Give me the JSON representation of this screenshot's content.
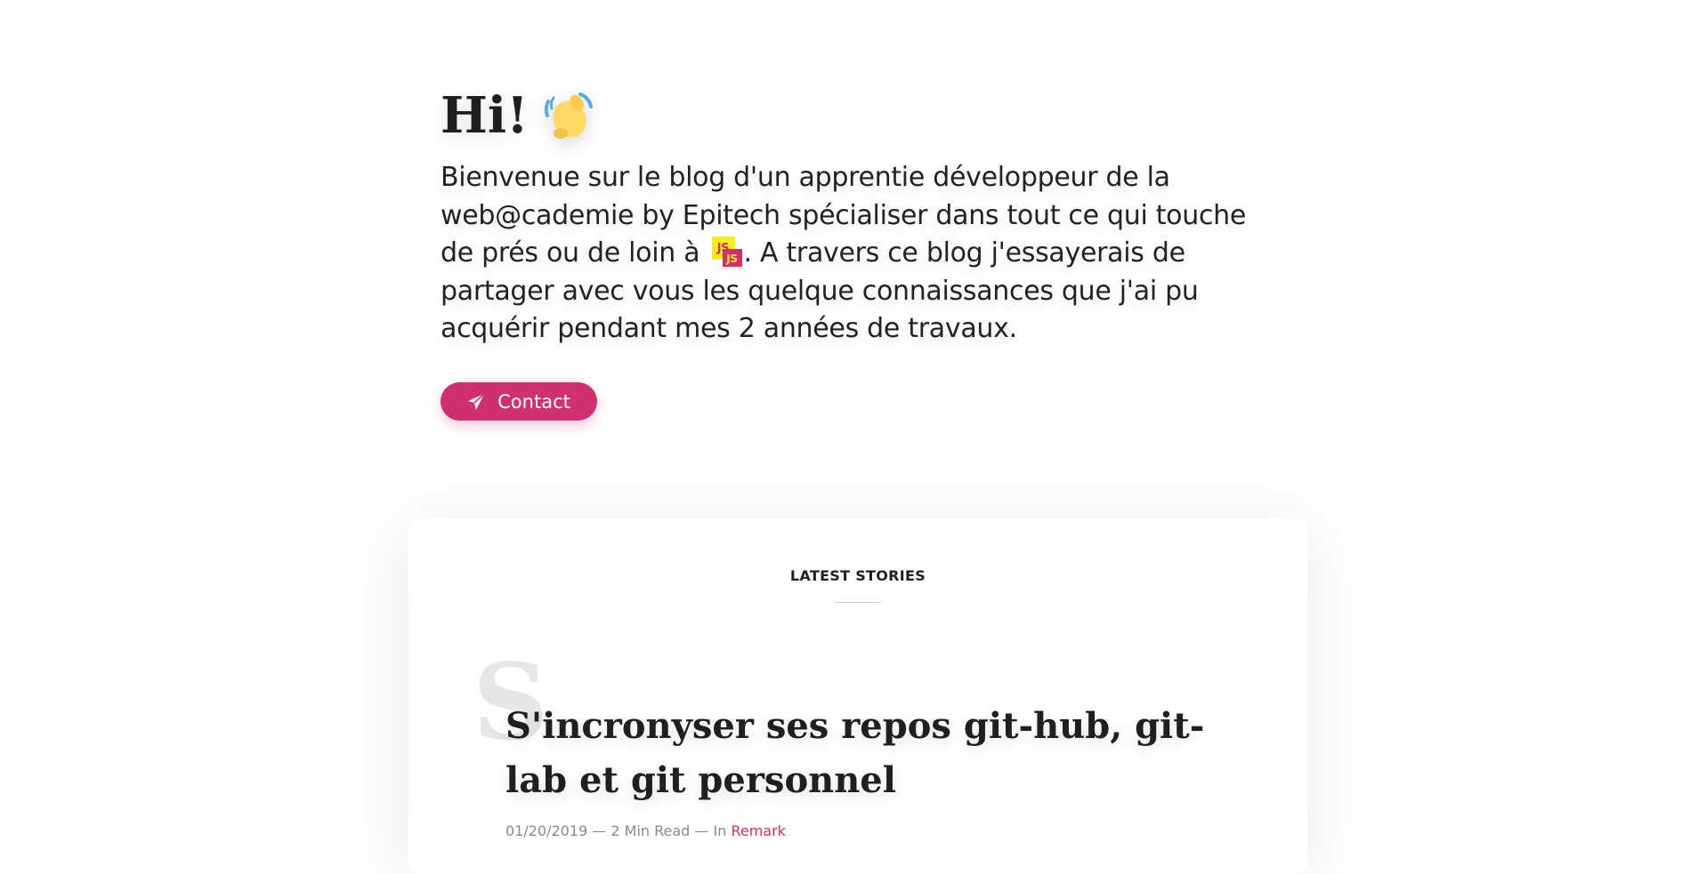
{
  "hero": {
    "greeting": "Hi!",
    "wave_icon": "waving-hand-icon",
    "intro_before": "Bienvenue sur le blog d'un apprentie développeur de la web@cademie by Epitech spécialiser dans tout ce qui touche de prés ou de loin à ",
    "js_badge": "JS",
    "intro_after": ". A travers ce blog j'essayerais de partager avec vous les quelque connaissances que j'ai pu acquérir pendant mes 2 années de travaux.",
    "contact_label": "Contact",
    "contact_icon": "paper-plane-icon"
  },
  "latest": {
    "title": "LATEST STORIES",
    "posts": [
      {
        "initial": "S",
        "title": "S'incronyser ses repos git-hub, git-lab et git personnel",
        "date": "01/20/2019",
        "sep1": " — ",
        "read_time": "2 Min Read",
        "sep2": " — In ",
        "category": "Remark"
      }
    ]
  },
  "colors": {
    "accent": "#d1306f",
    "js_yellow": "#f7ec1f"
  }
}
